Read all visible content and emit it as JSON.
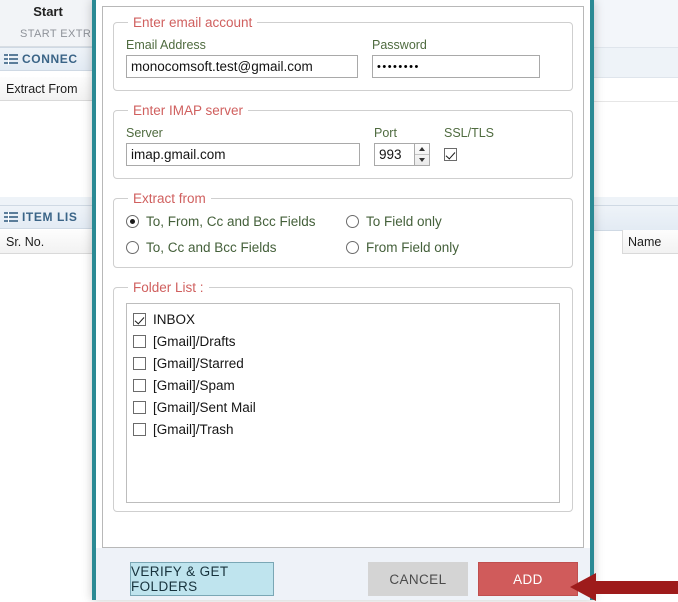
{
  "background": {
    "ribbon_tab": "Start",
    "ribbon_group": "START EXTR",
    "connect_panel_title": "CONNEC",
    "connect_column": "Extract From",
    "itemlist_panel_title": "ITEM LIS",
    "itemlist_column_srno": "Sr. No.",
    "itemlist_column_name": "Name"
  },
  "dialog": {
    "email_group": {
      "legend": "Enter email account",
      "email_label": "Email Address",
      "email_value": "monocomsoft.test@gmail.com",
      "password_label": "Password",
      "password_value": "••••••••"
    },
    "imap_group": {
      "legend": "Enter IMAP server",
      "server_label": "Server",
      "server_value": "imap.gmail.com",
      "port_label": "Port",
      "port_value": "993",
      "ssl_label": "SSL/TLS",
      "ssl_checked": true
    },
    "extract_group": {
      "legend": "Extract from",
      "options": [
        {
          "label": "To, From, Cc and Bcc Fields",
          "selected": true
        },
        {
          "label": "To Field only",
          "selected": false
        },
        {
          "label": "To, Cc and Bcc Fields",
          "selected": false
        },
        {
          "label": "From Field only",
          "selected": false
        }
      ]
    },
    "folder_group": {
      "legend": "Folder List :",
      "folders": [
        {
          "label": "INBOX",
          "checked": true
        },
        {
          "label": "[Gmail]/Drafts",
          "checked": false
        },
        {
          "label": "[Gmail]/Starred",
          "checked": false
        },
        {
          "label": "[Gmail]/Spam",
          "checked": false
        },
        {
          "label": "[Gmail]/Sent Mail",
          "checked": false
        },
        {
          "label": "[Gmail]/Trash",
          "checked": false
        }
      ]
    },
    "footer": {
      "verify_label": "VERIFY & GET FOLDERS",
      "cancel_label": "CANCEL",
      "add_label": "ADD"
    }
  },
  "colors": {
    "dialog_border_teal": "#2b8a94",
    "legend_red": "#d0605f",
    "field_label_green": "#4f6b3f",
    "add_button_red": "#d05b5b",
    "verify_button_blue": "#bfe4ee",
    "cancel_button_grey": "#d4d4d4",
    "annotation_arrow_red": "#9e1b1b",
    "panel_header_blue": "#3a6487"
  }
}
